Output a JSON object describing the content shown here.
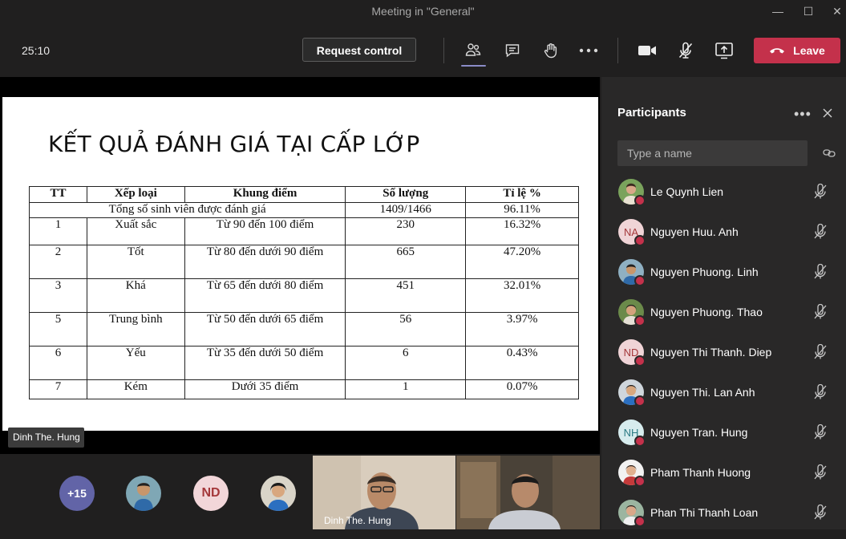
{
  "window": {
    "title": "Meeting in \"General\"",
    "minimize": "—",
    "maximize": "☐",
    "close": "✕"
  },
  "toolbar": {
    "timer": "25:10",
    "request_control": "Request control",
    "leave": "Leave",
    "icons": [
      "participants-icon",
      "chat-icon",
      "raise-hand-icon",
      "more-icon",
      "camera-icon",
      "mic-off-icon",
      "share-screen-icon"
    ]
  },
  "slide": {
    "title": "KẾT QUẢ ĐÁNH GIÁ TẠI CẤP LỚP",
    "headers": [
      "TT",
      "Xếp loại",
      "Khung điểm",
      "Số lượng",
      "Tỉ lệ %"
    ],
    "summary": {
      "label": "Tổng số sinh viên được đánh giá",
      "count": "1409/1466",
      "percent": "96.11%"
    },
    "rows": [
      [
        "1",
        "Xuất sắc",
        "Từ 90 đến 100 điểm",
        "230",
        "16.32%"
      ],
      [
        "2",
        "Tốt",
        "Từ 80 đến dưới 90 điểm",
        "665",
        "47.20%"
      ],
      [
        "3",
        "Khá",
        "Từ 65 đến dưới 80 điểm",
        "451",
        "32.01%"
      ],
      [
        "5",
        "Trung bình",
        "Từ 50 đến dưới 65 điểm",
        "56",
        "3.97%"
      ],
      [
        "6",
        "Yếu",
        "Từ 35 đến dưới 50 điểm",
        "6",
        "0.43%"
      ],
      [
        "7",
        "Kém",
        "Dưới 35 điểm",
        "1",
        "0.07%"
      ]
    ]
  },
  "presenter": "Dinh The. Hung",
  "strip": {
    "overflow": "+15",
    "initials": "ND",
    "video1_label": "Dinh The. Hung"
  },
  "panel": {
    "title": "Participants",
    "more": "•••",
    "search_placeholder": "Type a name",
    "participants": [
      {
        "name": "Le Quynh Lien",
        "initials": ""
      },
      {
        "name": "Nguyen Huu. Anh",
        "initials": "NA"
      },
      {
        "name": "Nguyen Phuong. Linh",
        "initials": ""
      },
      {
        "name": "Nguyen Phuong. Thao",
        "initials": ""
      },
      {
        "name": "Nguyen Thi Thanh. Diep",
        "initials": "ND"
      },
      {
        "name": "Nguyen Thi. Lan Anh",
        "initials": ""
      },
      {
        "name": "Nguyen Tran. Hung",
        "initials": "NH"
      },
      {
        "name": "Pham Thanh Huong",
        "initials": ""
      },
      {
        "name": "Phan Thi Thanh Loan",
        "initials": ""
      }
    ]
  },
  "colors": {
    "leave": "#c4314b",
    "accent": "#6264a7",
    "background": "#201f1f",
    "panel": "#292828"
  }
}
